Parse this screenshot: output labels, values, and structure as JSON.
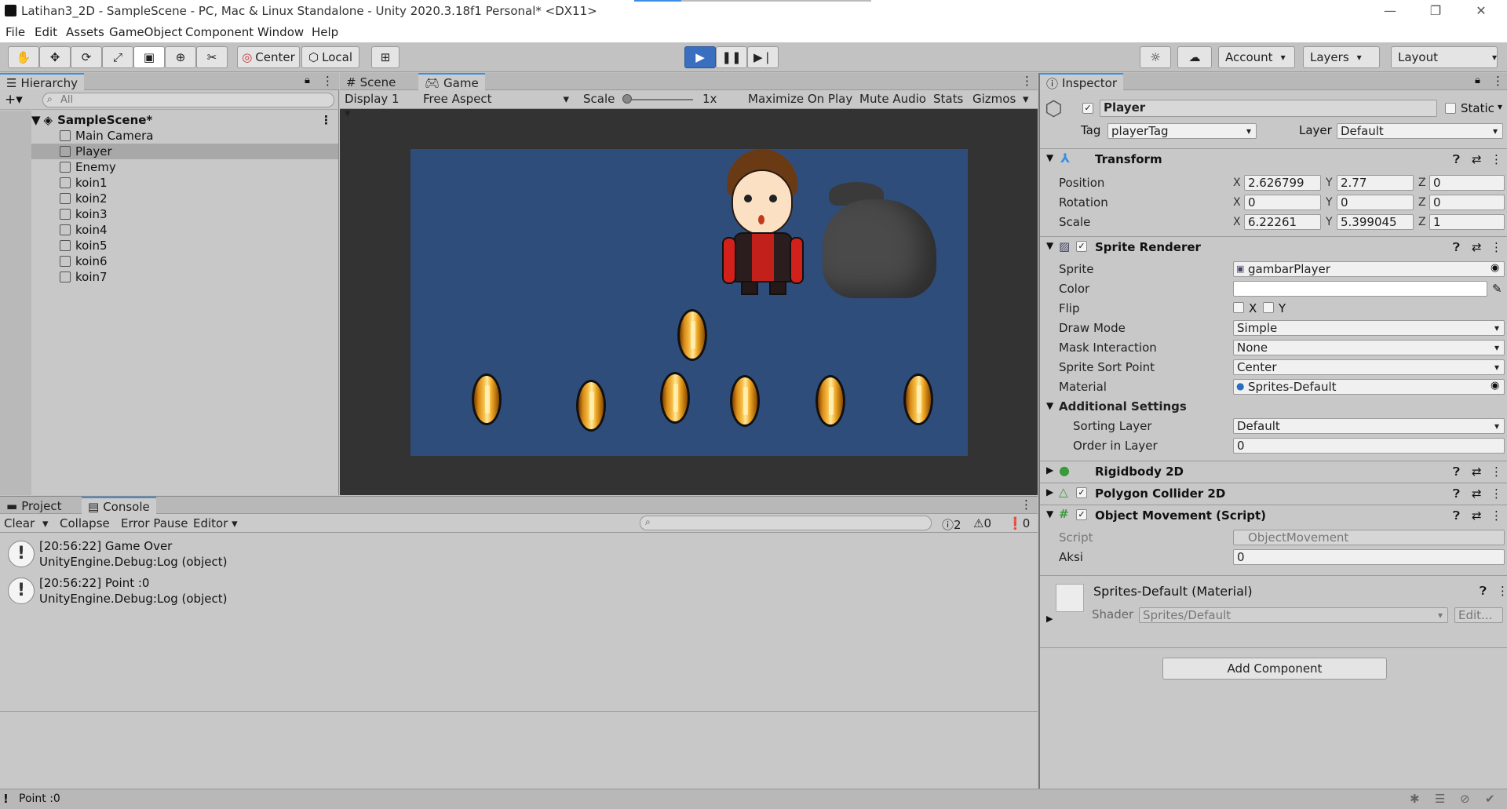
{
  "window": {
    "title": "Latihan3_2D - SampleScene - PC, Mac & Linux Standalone - Unity 2020.3.18f1 Personal* <DX11>",
    "controls": [
      "—",
      "❐",
      "✕"
    ]
  },
  "menu": [
    "File",
    "Edit",
    "Assets",
    "GameObject",
    "Component",
    "Window",
    "Help"
  ],
  "toolbar": {
    "pivot": "Center",
    "space": "Local",
    "account": "Account",
    "layers": "Layers",
    "layout": "Layout"
  },
  "hierarchy": {
    "tab": "Hierarchy",
    "search_placeholder": "All",
    "scene": "SampleScene*",
    "items": [
      "Main Camera",
      "Player",
      "Enemy",
      "koin1",
      "koin2",
      "koin3",
      "koin4",
      "koin5",
      "koin6",
      "koin7"
    ],
    "selected": "Player"
  },
  "game": {
    "tabs": [
      "Scene",
      "Game"
    ],
    "display": "Display 1",
    "aspect": "Free Aspect",
    "scale_label": "Scale",
    "scale_value": "1x",
    "maximize": "Maximize On Play",
    "mute": "Mute Audio",
    "stats": "Stats",
    "gizmos": "Gizmos"
  },
  "inspector": {
    "tab": "Inspector",
    "object_name": "Player",
    "static_label": "Static",
    "tag_label": "Tag",
    "tag_value": "playerTag",
    "layer_label": "Layer",
    "layer_value": "Default",
    "transform": {
      "title": "Transform",
      "position_label": "Position",
      "position": [
        "2.626799",
        "2.77",
        "0"
      ],
      "rotation_label": "Rotation",
      "rotation": [
        "0",
        "0",
        "0"
      ],
      "scale_label": "Scale",
      "scale": [
        "6.22261",
        "5.399045",
        "1"
      ]
    },
    "sprite_renderer": {
      "title": "Sprite Renderer",
      "sprite_label": "Sprite",
      "sprite": "gambarPlayer",
      "color_label": "Color",
      "flip_label": "Flip",
      "flip_x": "X",
      "flip_y": "Y",
      "draw_mode_label": "Draw Mode",
      "draw_mode": "Simple",
      "mask_label": "Mask Interaction",
      "mask": "None",
      "sort_point_label": "Sprite Sort Point",
      "sort_point": "Center",
      "material_label": "Material",
      "material": "Sprites-Default",
      "additional": "Additional Settings",
      "sorting_layer_label": "Sorting Layer",
      "sorting_layer": "Default",
      "order_label": "Order in Layer",
      "order": "0"
    },
    "rigidbody": "Rigidbody 2D",
    "collider": "Polygon Collider 2D",
    "script": {
      "title": "Object Movement (Script)",
      "script_label": "Script",
      "script_value": "ObjectMovement",
      "aksi_label": "Aksi",
      "aksi_value": "0"
    },
    "material_section": {
      "title": "Sprites-Default (Material)",
      "shader_label": "Shader",
      "shader": "Sprites/Default",
      "edit": "Edit..."
    },
    "add_component": "Add Component"
  },
  "console": {
    "tabs": [
      "Project",
      "Console"
    ],
    "clear": "Clear",
    "collapse": "Collapse",
    "error_pause": "Error Pause",
    "editor": "Editor",
    "count_log": "2",
    "count_warn": "0",
    "count_err": "0",
    "logs": [
      {
        "line1": "[20:56:22] Game Over",
        "line2": "UnityEngine.Debug:Log (object)"
      },
      {
        "line1": "[20:56:22] Point :0",
        "line2": "UnityEngine.Debug:Log (object)"
      }
    ]
  },
  "status": "Point :0",
  "colors": {
    "accent": "#3a8ee6",
    "play": "#3a6fbf",
    "game_bg": "#2f4d7b"
  }
}
